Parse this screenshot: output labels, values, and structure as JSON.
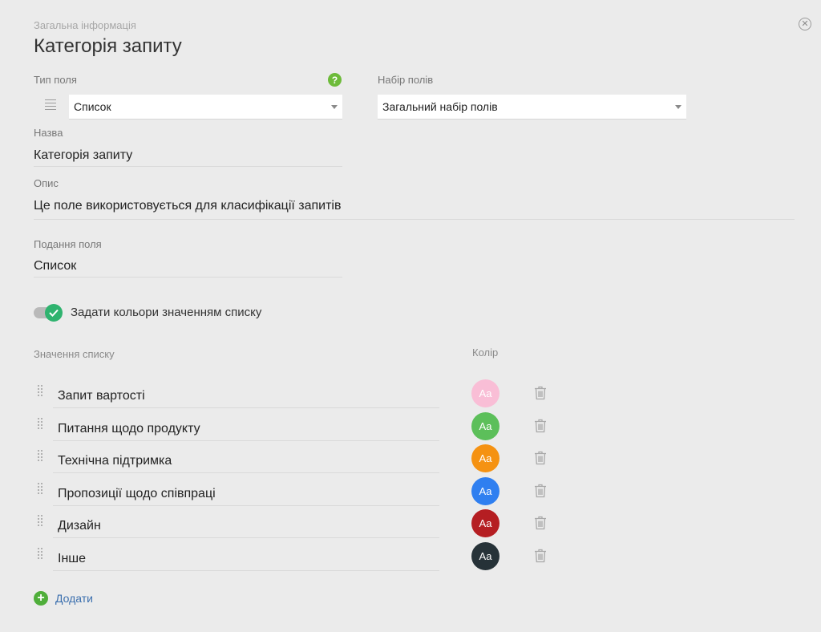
{
  "header": {
    "section_label": "Загальна інформація",
    "title": "Категорія запиту",
    "close_icon": "close-circle-icon"
  },
  "field_type": {
    "label": "Тип поля",
    "value": "Список",
    "help_icon": "question-icon"
  },
  "field_set": {
    "label": "Набір полів",
    "value": "Загальний набір полів"
  },
  "name": {
    "label": "Назва",
    "value": "Категорія запиту"
  },
  "description": {
    "label": "Опис",
    "value": "Це поле використовується для класифікації запитів"
  },
  "presentation": {
    "label": "Подання поля",
    "value": "Список"
  },
  "color_toggle": {
    "label": "Задати кольори значенням списку",
    "checked": true
  },
  "list": {
    "values_header": "Значення списку",
    "color_header": "Колір",
    "swatch_text": "Aa",
    "items": [
      {
        "label": "Запит вартості",
        "color": "#f9bed6",
        "text_color": "#ffffff"
      },
      {
        "label": "Питання щодо продукту",
        "color": "#5cbf5a",
        "text_color": "#ffffff"
      },
      {
        "label": "Технічна підтримка",
        "color": "#f59212",
        "text_color": "#ffffff"
      },
      {
        "label": "Пропозиції щодо співпраці",
        "color": "#2f7ff0",
        "text_color": "#ffffff"
      },
      {
        "label": "Дизайн",
        "color": "#b51e22",
        "text_color": "#ffffff"
      },
      {
        "label": "Інше",
        "color": "#263238",
        "text_color": "#ffffff"
      }
    ]
  },
  "add_button": {
    "label": "Додати",
    "icon": "plus-circle-icon"
  }
}
